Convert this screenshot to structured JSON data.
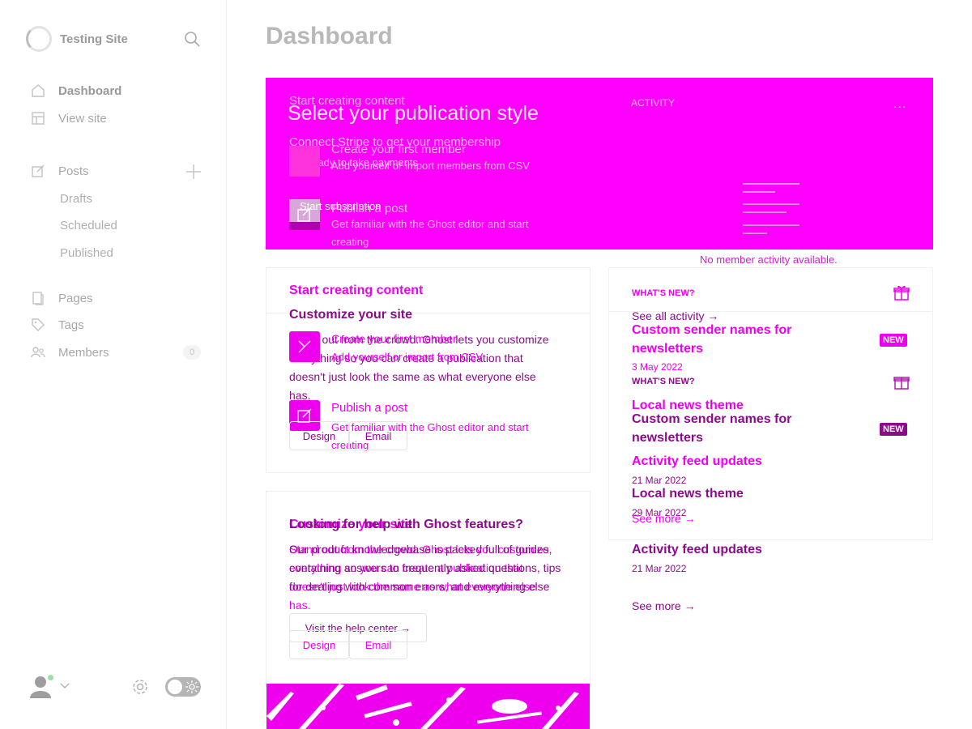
{
  "sidebar": {
    "site_name": "Testing Site",
    "nav": {
      "dashboard": "Dashboard",
      "view_site": "View site",
      "posts": "Posts",
      "drafts": "Drafts",
      "scheduled": "Scheduled",
      "published": "Published",
      "pages": "Pages",
      "tags": "Tags",
      "members": "Members",
      "members_count": "0"
    }
  },
  "main": {
    "title": "Dashboard",
    "banner": {
      "title": "Select your publication style",
      "ghost_start": "Start creating content",
      "ghost_activity": "ACTIVITY",
      "ghost_more": "...",
      "ghost_create_member": "Create your first member",
      "ghost_add_member": "Add yourself or import members from CSV",
      "ghost_stripe": "Connect Stripe to get your membership",
      "ghost_stripe2": "site ready to take payments",
      "ghost_publish": "Publish a post",
      "ghost_editor": "Get familiar with the Ghost editor and start",
      "ghost_creating": "creating",
      "ghost_start_subscription": "Start subscription"
    },
    "no_activity": "No member activity available.",
    "start_card": {
      "title": "Start creating content",
      "customize_title": "Customize your site",
      "customize_text_1": "Stand out from the crowd. Ghost lets you customize",
      "customize_text_2": "everything so you can create a publication that",
      "customize_text_3": "doesn't just look the same as what everyone else",
      "customize_text_4": "has.",
      "create_member": "Create your first member",
      "add_member": "Add yourself or import from CSV",
      "publish_post": "Publish a post",
      "editor_text_1": "Get familiar with the Ghost editor and start",
      "editor_text_2": "creating",
      "design_label": "Design",
      "email_label": "Email"
    },
    "whats_new_card": {
      "heading": "WHAT'S NEW?",
      "see_all_activity": "See all activity →",
      "items": [
        {
          "title_1": "Custom sender names for",
          "title_2": "newsletters",
          "date": "3 May 2022",
          "badge": "NEW"
        },
        {
          "title": "Local news theme",
          "date": "29 Mar 2022"
        },
        {
          "title": "Activity feed updates",
          "date": "21 Mar 2022"
        }
      ],
      "see_more": "See more →"
    },
    "help_card": {
      "title": "Looking for help with Ghost features?",
      "ghost_title": "Customize your site",
      "text_1": "Our product knowledgebase is packed full of guides,",
      "text_2": "containing answers to frequently asked questions, tips",
      "text_3": "for dealing with common errors, and everything else",
      "text_4": "has.",
      "ghost_text_1": "Stand out from the crowd. Ghost lets you customize",
      "ghost_text_2": "everything so you can create a publication that",
      "ghost_text_3": "doesn't just look the same as what everyone else",
      "help_button": "Visit the help center →",
      "design_label": "Design",
      "email_label": "Email"
    }
  },
  "colors": {
    "accent": "#ff00ff",
    "accent_strong": "#ee00ee",
    "accent_dark": "#8b0b8b"
  }
}
